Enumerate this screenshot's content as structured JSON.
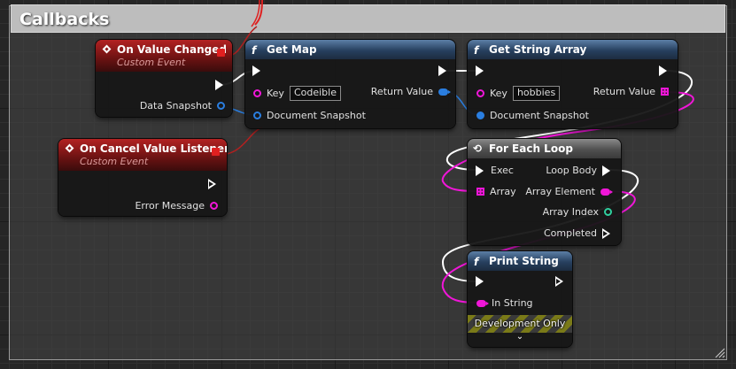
{
  "comment": {
    "title": "Callbacks"
  },
  "nodes": {
    "on_value_changed": {
      "title": "On Value Changed",
      "subtitle": "Custom Event",
      "pins": {
        "data_snapshot": "Data Snapshot"
      }
    },
    "on_cancel": {
      "title": "On Cancel Value Listener",
      "subtitle": "Custom Event",
      "pins": {
        "error_message": "Error Message"
      }
    },
    "get_map": {
      "icon": "f",
      "title": "Get Map",
      "pins": {
        "key": "Key",
        "key_value": "Codeible",
        "return_value": "Return Value",
        "document_snapshot": "Document Snapshot"
      }
    },
    "get_string_array": {
      "icon": "f",
      "title": "Get String Array",
      "pins": {
        "key": "Key",
        "key_value": "hobbies",
        "return_value": "Return Value",
        "document_snapshot": "Document Snapshot"
      }
    },
    "for_each_loop": {
      "title": "For Each Loop",
      "pins": {
        "exec": "Exec",
        "array": "Array",
        "loop_body": "Loop Body",
        "array_element": "Array Element",
        "array_index": "Array Index",
        "completed": "Completed"
      }
    },
    "print_string": {
      "icon": "f",
      "title": "Print String",
      "pins": {
        "in_string": "In String"
      },
      "footer": "Development Only",
      "expand_glyph": "⌄"
    }
  },
  "colors": {
    "exec": "#ffffff",
    "string": "#f016d8",
    "object": "#2a7ee0",
    "integer": "#30d0a0",
    "event_delegate": "#e02020"
  }
}
